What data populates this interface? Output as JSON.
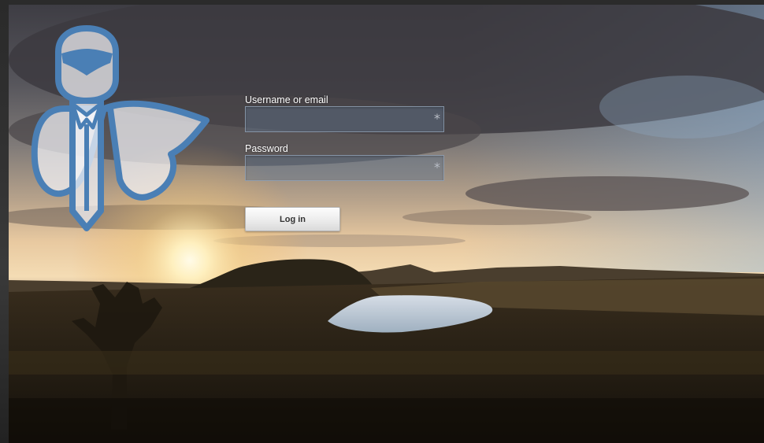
{
  "background": {
    "sky_top": "#4e4c52",
    "sky_horizon": "#f2d8b0",
    "sun_color": "#fff6d0",
    "land_color": "#201a10",
    "water_color": "#c8d2dc"
  },
  "logo": {
    "icon": "keycloak-key-knight-icon",
    "color": "#4a7fb5"
  },
  "login_form": {
    "username_label": "Username or email",
    "username_value": "",
    "username_required_marker": "*",
    "password_label": "Password",
    "password_value": "",
    "password_required_marker": "*",
    "login_button_label": "Log in"
  }
}
